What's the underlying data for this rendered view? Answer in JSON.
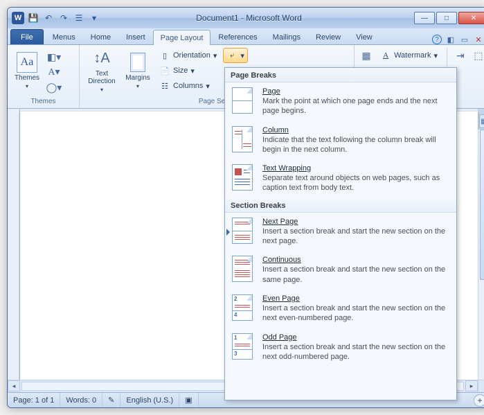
{
  "titlebar": {
    "app_letter": "W",
    "title": "Document1 - Microsoft Word"
  },
  "tabs": {
    "file": "File",
    "items": [
      "Menus",
      "Home",
      "Insert",
      "Page Layout",
      "References",
      "Mailings",
      "Review",
      "View"
    ],
    "active_index": 3
  },
  "ribbon": {
    "themes": {
      "label": "Themes",
      "btn": "Themes"
    },
    "page_setup": {
      "label": "Page Setup",
      "text_direction": "Text Direction",
      "margins": "Margins",
      "orientation": "Orientation",
      "size": "Size",
      "columns": "Columns"
    },
    "watermark": "Watermark"
  },
  "dropdown": {
    "section1": "Page Breaks",
    "section2": "Section Breaks",
    "items_page": [
      {
        "title": "Page",
        "desc": "Mark the point at which one page ends and the next page begins."
      },
      {
        "title": "Column",
        "desc": "Indicate that the text following the column break will begin in the next column."
      },
      {
        "title": "Text Wrapping",
        "desc": "Separate text around objects on web pages, such as caption text from body text."
      }
    ],
    "items_section": [
      {
        "title": "Next Page",
        "desc": "Insert a section break and start the new section on the next page."
      },
      {
        "title": "Continuous",
        "desc": "Insert a section break and start the new section on the same page."
      },
      {
        "title": "Even Page",
        "desc": "Insert a section break and start the new section on the next even-numbered page."
      },
      {
        "title": "Odd Page",
        "desc": "Insert a section break and start the new section on the next odd-numbered page."
      }
    ]
  },
  "statusbar": {
    "page": "Page: 1 of 1",
    "words": "Words: 0",
    "language": "English (U.S.)"
  }
}
